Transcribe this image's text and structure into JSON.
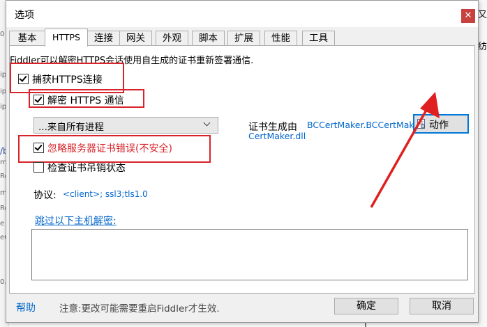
{
  "background": {
    "left_fragments": [
      "0",
      "ip",
      "ip",
      "ip",
      "/b",
      "mi",
      "Ro",
      "mi",
      "Ro",
      "e",
      "eC",
      "0."
    ],
    "right_fragments": [
      "又",
      "纺"
    ]
  },
  "dialog": {
    "title": "选项",
    "close_glyph": "✕"
  },
  "tabs": [
    "基本",
    "HTTPS",
    "连接",
    "网关",
    "外观",
    "脚本",
    "扩展",
    "性能",
    "工具"
  ],
  "active_tab": "HTTPS",
  "https": {
    "intro": "Fiddler可以解密HTTPS会话使用自生成的证书重新签署通信.",
    "capture_label": "捕获HTTPS连接",
    "capture_checked": true,
    "decrypt_label": "解密 HTTPS 通信",
    "decrypt_checked": true,
    "process_select": "...来自所有进程",
    "ignore_errors_label": "忽略服务器证书错误(不安全)",
    "ignore_errors_checked": true,
    "revocation_label": "检查证书吊销状态",
    "revocation_checked": false,
    "cert_gen_label": "证书生成由",
    "cert_gen_value_1": "BCCertMaker.BCCertMaker from",
    "cert_gen_value_2": "CertMaker.dll",
    "protocol_label": "协议:",
    "protocol_value": "<client>; ssl3;tls1.0",
    "skip_hosts_link": "跳过以下主机解密:",
    "skip_hosts_value": "",
    "action_button": "动作"
  },
  "footer": {
    "help": "帮助",
    "note": "注意:更改可能需要重启Fiddler才生效.",
    "ok": "确定",
    "cancel": "取消"
  },
  "colors": {
    "annotation_red": "#d8232a",
    "link_blue": "#0066cc",
    "warning_red": "#d8232a"
  }
}
